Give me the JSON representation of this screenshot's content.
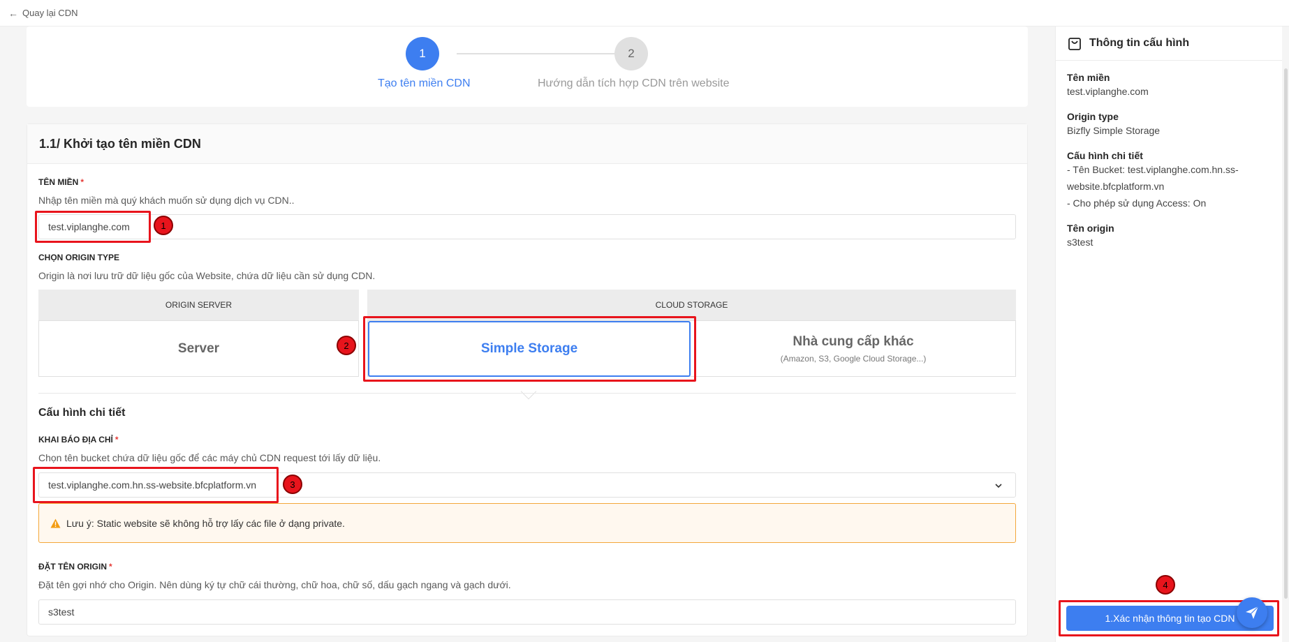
{
  "topbar": {
    "back_label": "Quay lại CDN"
  },
  "stepper": {
    "steps": [
      {
        "number": "1",
        "label": "Tạo tên miền CDN"
      },
      {
        "number": "2",
        "label": "Hướng dẫn tích hợp CDN trên website"
      }
    ]
  },
  "form": {
    "title": "1.1/ Khởi tạo tên miền CDN",
    "domain": {
      "label": "TÊN MIỀN",
      "required_mark": "*",
      "description": "Nhập tên miền mà quý khách muốn sử dụng dịch vụ CDN..",
      "value": "test.viplanghe.com"
    },
    "origin_type": {
      "label": "CHỌN ORIGIN TYPE",
      "description": "Origin là nơi lưu trữ dữ liệu gốc của Website, chứa dữ liệu cần sử dụng CDN.",
      "tabs": [
        "ORIGIN SERVER",
        "CLOUD STORAGE"
      ],
      "options": {
        "server": "Server",
        "simple_storage": "Simple Storage",
        "other_title": "Nhà cung cấp khác",
        "other_sub": "(Amazon, S3, Google Cloud Storage...)"
      }
    },
    "detail": {
      "section_title": "Cấu hình chi tiết",
      "address_label": "KHAI BÁO ĐỊA CHỈ",
      "address_required": "*",
      "address_description": "Chọn tên bucket chứa dữ liệu gốc để các máy chủ CDN request tới lấy dữ liệu.",
      "bucket_value": "test.viplanghe.com.hn.ss-website.bfcplatform.vn",
      "warning": "Lưu ý: Static website sẽ không hỗ trợ lấy các file ở dạng private.",
      "origin_name_label": "ĐẶT TÊN ORIGIN",
      "origin_name_required": "*",
      "origin_name_description": "Đặt tên gợi nhớ cho Origin. Nên dùng ký tự chữ cái thường, chữ hoa, chữ số, dấu gạch ngang và gạch dưới.",
      "origin_name_value": "s3test"
    }
  },
  "markers": [
    "1",
    "2",
    "3",
    "4"
  ],
  "panel": {
    "title": "Thông tin cấu hình",
    "domain_label": "Tên miền",
    "domain_value": "test.viplanghe.com",
    "origin_type_label": "Origin type",
    "origin_type_value": "Bizfly Simple Storage",
    "detail_label": "Cấu hình chi tiết",
    "detail_line1a": "- Tên Bucket: test.viplanghe.com.hn.ss-",
    "detail_line1b": "website.bfcplatform.vn",
    "detail_line2": "- Cho phép sử dụng Access: On",
    "origin_name_label": "Tên origin",
    "origin_name_value": "s3test",
    "confirm_button": "1.Xác nhận thông tin tạo CDN"
  },
  "colors": {
    "primary": "#3d7ef0",
    "annotation": "#e8141c",
    "warning_border": "#f3a73a"
  },
  "icons": [
    "back-arrow-icon",
    "shopping-bag-icon",
    "warning-icon",
    "chevron-down-icon",
    "paper-plane-icon"
  ]
}
